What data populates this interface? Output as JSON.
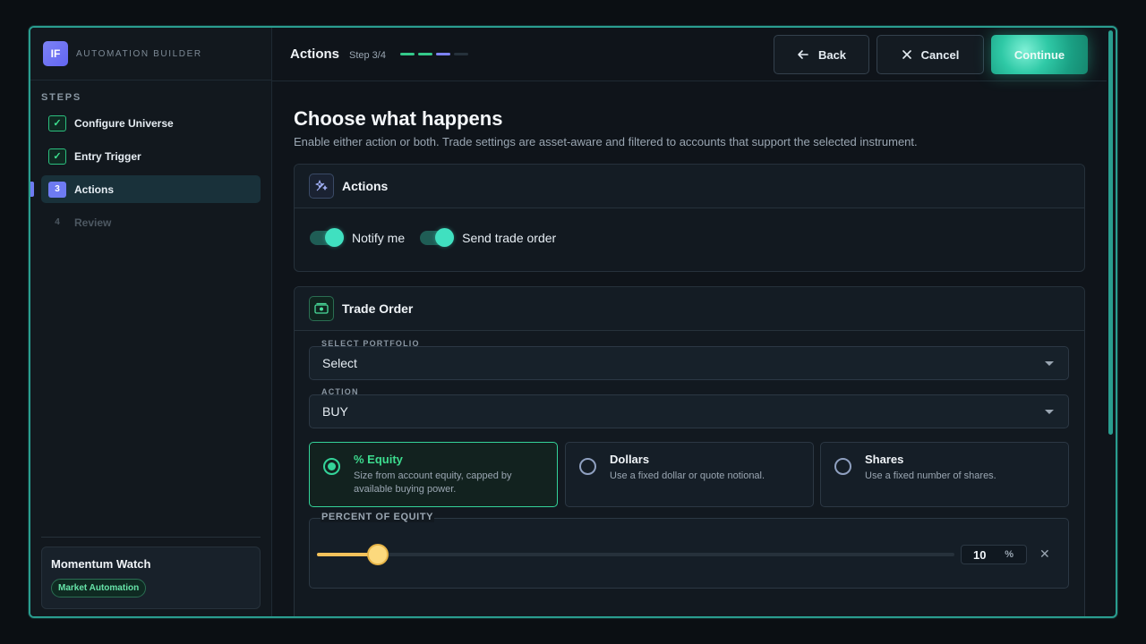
{
  "brand": {
    "logo": "IF",
    "name": "AUTOMATION BUILDER"
  },
  "sidebar": {
    "steps_title": "STEPS",
    "steps": [
      {
        "label": "Configure Universe",
        "state": "complete",
        "marker": "✓"
      },
      {
        "label": "Entry Trigger",
        "state": "complete",
        "marker": "✓"
      },
      {
        "label": "Actions",
        "state": "active",
        "marker": "3"
      },
      {
        "label": "Review",
        "state": "upcoming",
        "marker": "4"
      }
    ],
    "card": {
      "title": "Momentum Watch",
      "badge": "Market Automation"
    }
  },
  "header": {
    "title": "Actions",
    "step_text": "Step 3/4",
    "progress": {
      "current": 3,
      "total": 4
    },
    "back_label": "Back",
    "cancel_label": "Cancel",
    "continue_label": "Continue"
  },
  "content": {
    "heading": "Choose what happens",
    "subtitle": "Enable either action or both. Trade settings are asset-aware and filtered to accounts that support the selected instrument."
  },
  "actions_panel": {
    "title": "Actions",
    "icon": "sparkles-icon",
    "toggles": [
      {
        "label": "Notify me",
        "on": true
      },
      {
        "label": "Send trade order",
        "on": true
      }
    ]
  },
  "trade_panel": {
    "title": "Trade Order",
    "icon": "cash-icon",
    "portfolio": {
      "label": "SELECT PORTFOLIO",
      "value": "Select"
    },
    "action": {
      "label": "ACTION",
      "value": "BUY"
    },
    "sizing_options": [
      {
        "title": "% Equity",
        "desc": "Size from account equity, capped by available buying power.",
        "selected": true
      },
      {
        "title": "Dollars",
        "desc": "Use a fixed dollar or quote notional.",
        "selected": false
      },
      {
        "title": "Shares",
        "desc": "Use a fixed number of shares.",
        "selected": false
      }
    ],
    "percent": {
      "label": "PERCENT OF EQUITY",
      "value": "10",
      "unit": "%",
      "fraction": 0.095
    }
  },
  "colors": {
    "accent": "#2a9d8f",
    "success": "#34d399",
    "step_active": "#6e7bf2",
    "slider": "#f4c25b"
  }
}
